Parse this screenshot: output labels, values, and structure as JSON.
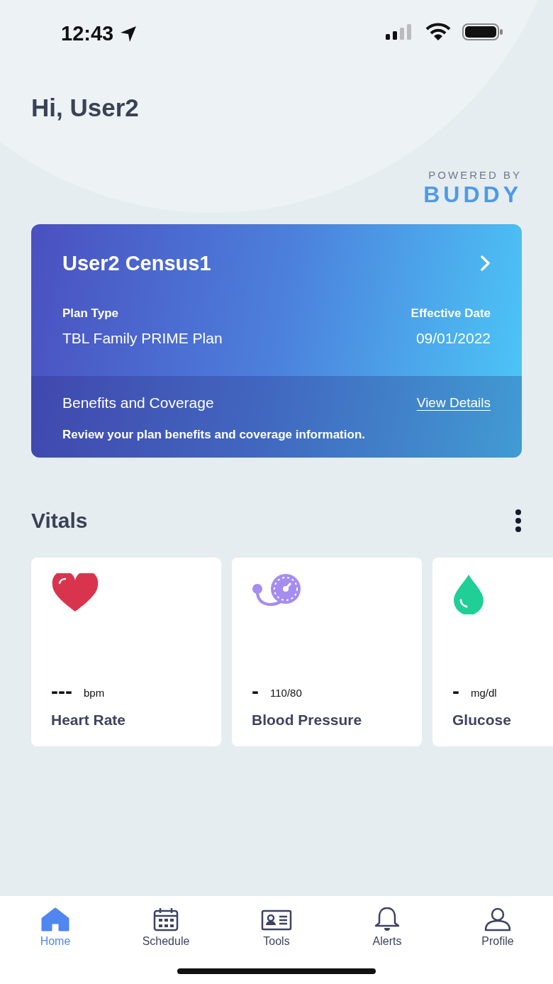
{
  "status_bar": {
    "time": "12:43"
  },
  "greeting": "Hi, User2",
  "powered_by": {
    "label": "POWERED BY",
    "brand": "BUDDY"
  },
  "plan_card": {
    "member": "User2 Census1",
    "plan_type_label": "Plan Type",
    "plan_type": "TBL Family PRIME Plan",
    "effective_date_label": "Effective Date",
    "effective_date": "09/01/2022",
    "benefits_title": "Benefits and Coverage",
    "view_details": "View Details",
    "benefits_description": "Review your plan benefits and coverage information."
  },
  "vitals": {
    "title": "Vitals",
    "items": [
      {
        "kind": "heart",
        "value": "---",
        "unit": "bpm",
        "name": "Heart Rate"
      },
      {
        "kind": "pressure",
        "value": "-",
        "unit": "110/80",
        "name": "Blood Pressure"
      },
      {
        "kind": "glucose",
        "value": "-",
        "unit": "mg/dl",
        "name": "Glucose"
      }
    ]
  },
  "nav": [
    {
      "kind": "home",
      "label": "Home",
      "selected": true
    },
    {
      "kind": "schedule",
      "label": "Schedule",
      "selected": false
    },
    {
      "kind": "tools",
      "label": "Tools",
      "selected": false
    },
    {
      "kind": "alerts",
      "label": "Alerts",
      "selected": false
    },
    {
      "kind": "profile",
      "label": "Profile",
      "selected": false
    }
  ]
}
